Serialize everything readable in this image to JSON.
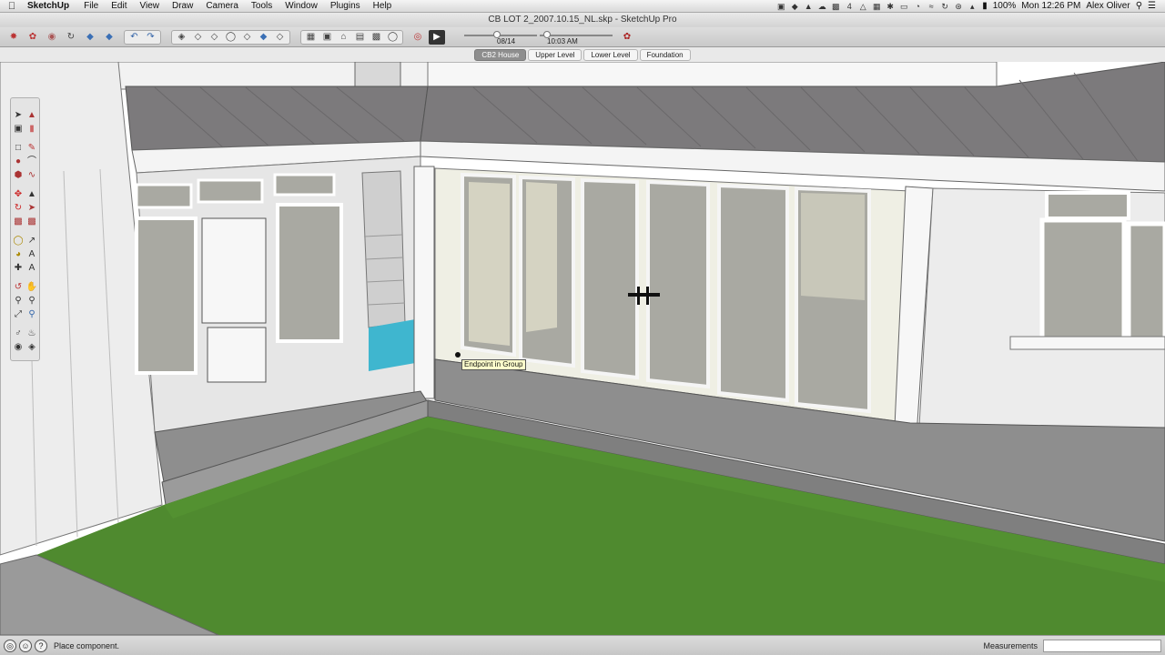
{
  "menubar": {
    "app_name": "SketchUp",
    "menus": [
      "File",
      "Edit",
      "View",
      "Draw",
      "Camera",
      "Tools",
      "Window",
      "Plugins",
      "Help"
    ],
    "battery": "100%",
    "clock": "Mon 12:26 PM",
    "user": "Alex Oliver",
    "badge_count": "4"
  },
  "window": {
    "title": "CB LOT 2_2007.10.15_NL.skp - SketchUp Pro"
  },
  "toolbar": {
    "shadow_date": "08/14",
    "shadow_time": "10:03 AM"
  },
  "scenes": {
    "tabs": [
      {
        "label": "CB2 House",
        "active": true
      },
      {
        "label": "Upper Level",
        "active": false
      },
      {
        "label": "Lower Level",
        "active": false
      },
      {
        "label": "Foundation",
        "active": false
      }
    ]
  },
  "viewport": {
    "inference_tooltip": "Endpoint in Group"
  },
  "statusbar": {
    "hint": "Place component.",
    "measurements_label": "Measurements",
    "measurements_value": ""
  },
  "colors": {
    "grass": "#4f8a2f",
    "roof": "#7c7a7c",
    "deck": "#8e8e8e",
    "glass": "#a9a9a2",
    "water": "#3fb6cf"
  }
}
